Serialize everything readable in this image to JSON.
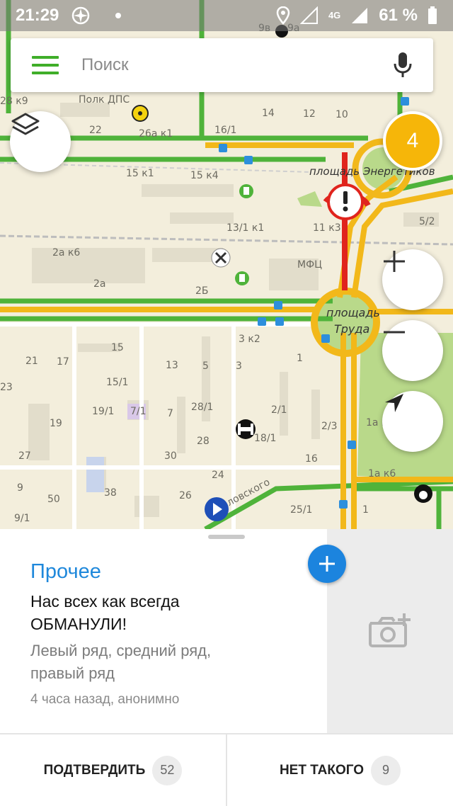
{
  "status_bar": {
    "time": "21:29",
    "network": "4G",
    "battery": "61 %"
  },
  "search": {
    "placeholder": "Поиск"
  },
  "map": {
    "traffic_level": "4",
    "labels": {
      "polk_dps": "Полк ДПС",
      "b9v": "9в",
      "b9a": "9а",
      "b28k9": "28 к9",
      "b14": "14",
      "b12": "12",
      "b10": "10",
      "b22": "22",
      "b26ak1": "26а к1",
      "b16_1": "16/1",
      "b15k1": "15 к1",
      "b15k4": "15 к4",
      "sq_energ": "площадь Энергетиков",
      "b5_2": "5/2",
      "b13_1k1": "13/1 к1",
      "b11k3": "11 к3",
      "b2ak6": "2а к6",
      "mfc": "МФЦ",
      "b2a": "2а",
      "b2b": "2Б",
      "sq_truda_1": "площадь",
      "sq_truda_2": "Труда",
      "b3k2": "3 к2",
      "b15": "15",
      "b21": "21",
      "b17": "17",
      "b13": "13",
      "b5": "5",
      "b3": "3",
      "b1": "1",
      "b15_1": "15/1",
      "b23": "23",
      "b19_1": "19/1",
      "b7_1": "7/1",
      "b7": "7",
      "b28_1": "28/1",
      "b2_1": "2/1",
      "b1a": "1а к",
      "b19": "19",
      "b18_1": "18/1",
      "b2_3": "2/3",
      "b27": "27",
      "b30": "30",
      "b28": "28",
      "b16": "16",
      "b9": "9",
      "b38": "38",
      "b24": "24",
      "b1ak6": "1а к6",
      "b50": "50",
      "b26": "26",
      "b25_1": "25/1",
      "b9_1": "9/1",
      "b1bot": "1",
      "street": "ловского"
    }
  },
  "event": {
    "category": "Прочее",
    "headline": "Нас всех как всегда ОБМАНУЛИ!",
    "description": "Левый ряд, средний ряд, правый ряд",
    "meta": "4 часа назад, анонимно"
  },
  "actions": {
    "confirm_label": "ПОДТВЕРДИТЬ",
    "confirm_count": "52",
    "deny_label": "НЕТ ТАКОГО",
    "deny_count": "9"
  },
  "colors": {
    "brand_green": "#3fae29",
    "accent_blue": "#1f88db",
    "traffic_yellow": "#f6b609",
    "traffic_red": "#e0241d"
  },
  "icons": [
    "menu-icon",
    "microphone-icon",
    "layers-icon",
    "plus-icon",
    "minus-icon",
    "navigation-arrow-icon",
    "add-photo-icon",
    "plus-icon",
    "warning-icon",
    "fuel-icon",
    "service-icon",
    "gym-icon",
    "bus-stop-icon",
    "play-icon"
  ]
}
